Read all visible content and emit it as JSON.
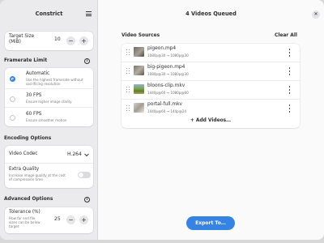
{
  "app": {
    "title": "Constrict"
  },
  "target_size": {
    "label": "Target Size",
    "unit": "(MiB)",
    "value": "10",
    "minus": "−",
    "plus": "+"
  },
  "framerate": {
    "title": "Framerate Limit",
    "info_icon": "info-icon",
    "options": [
      {
        "label": "Automatic",
        "desc_line1": "Use the highest framerate without",
        "desc_line2": "sacrificing resolution",
        "selected": true
      },
      {
        "label": "30 FPS",
        "desc_line1": "Ensure higher image clarity",
        "selected": false
      },
      {
        "label": "60 FPS",
        "desc_line1": "Ensure smoother motion",
        "selected": false
      }
    ]
  },
  "encoding": {
    "title": "Encoding Options",
    "codec_label": "Video Codec",
    "codec_value": "H.264",
    "extra_label": "Extra Quality",
    "extra_desc_line1": "Increase image quality at the cost",
    "extra_desc_line2": "of compression time",
    "extra_enabled": false
  },
  "advanced": {
    "title": "Advanced Options",
    "info_icon": "info-icon",
    "tolerance_label": "Tolerance (%)",
    "tolerance_desc_line1": "How far end file",
    "tolerance_desc_line2": "sizes can be below",
    "tolerance_desc_line3": "target",
    "tolerance_value": "25",
    "minus": "−",
    "plus": "+"
  },
  "main": {
    "title": "4 Videos Queued",
    "close_glyph": "✕",
    "sources_title": "Video Sources",
    "clear_all": "Clear All",
    "add_videos": "+ Add Videos…",
    "export": "Export To…"
  },
  "videos": [
    {
      "name": "pigeon.mp4",
      "meta": "1080p@30 → 1080p@30",
      "thumb_color": "#8f8a7e"
    },
    {
      "name": "big-pigeon.mp4",
      "meta": "1080p@30 → 1080p@30",
      "thumb_color": "#9c968a"
    },
    {
      "name": "bloons-clip.mkv",
      "meta": "1440p@60 → 1080p@60",
      "thumb_color": "#6f8a3d"
    },
    {
      "name": "portal-full.mkv",
      "meta": "1440p@60 → 144p@24",
      "thumb_color": "#b8b2a8"
    }
  ],
  "colors": {
    "accent": "#3584e4",
    "sidebar_bg": "#ebebed",
    "main_bg": "#fafafa"
  }
}
